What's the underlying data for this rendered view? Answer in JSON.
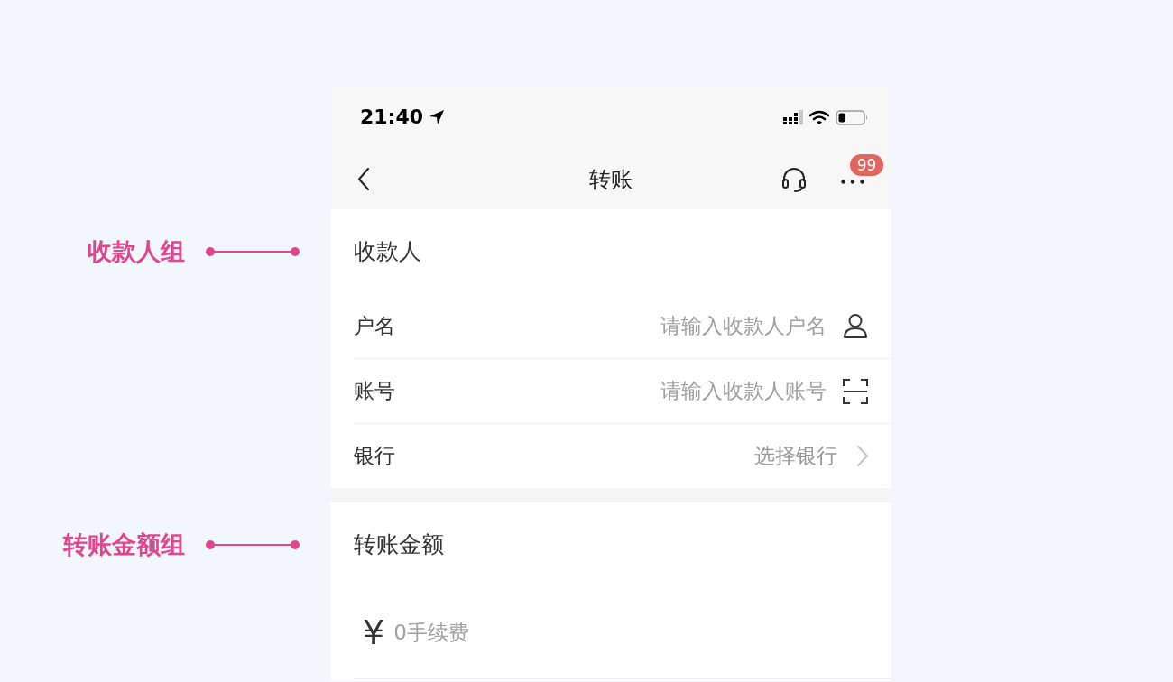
{
  "status_bar": {
    "time": "21:40"
  },
  "nav_bar": {
    "title": "转账",
    "badge": "99"
  },
  "sections": [
    {
      "kind": "payee",
      "annotation": "收款人组",
      "title": "收款人",
      "rows": [
        {
          "kind": "contact",
          "label": "户名",
          "placeholder": "请输入收款人户名"
        },
        {
          "kind": "scan",
          "label": "账号",
          "placeholder": "请输入收款人账号"
        },
        {
          "kind": "picker",
          "label": "银行",
          "placeholder": "选择银行"
        }
      ]
    },
    {
      "kind": "amount",
      "annotation": "转账金额组",
      "title": "转账金额",
      "currency": "¥",
      "placeholder": "0手续费"
    }
  ]
}
